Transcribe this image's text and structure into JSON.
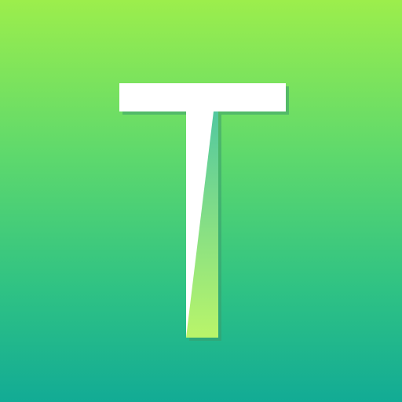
{
  "icon": {
    "name": "t-letter-icon",
    "glyph": "T",
    "colors": {
      "background_top": "#9cee4c",
      "background_mid": "#5fd96c",
      "background_low": "#2fc284",
      "background_bottom": "#12ab95",
      "letter": "#ffffff",
      "shadow": "#3a9a6c",
      "fold_top": "#52c8a0",
      "fold_bottom": "#b9f56a"
    }
  }
}
